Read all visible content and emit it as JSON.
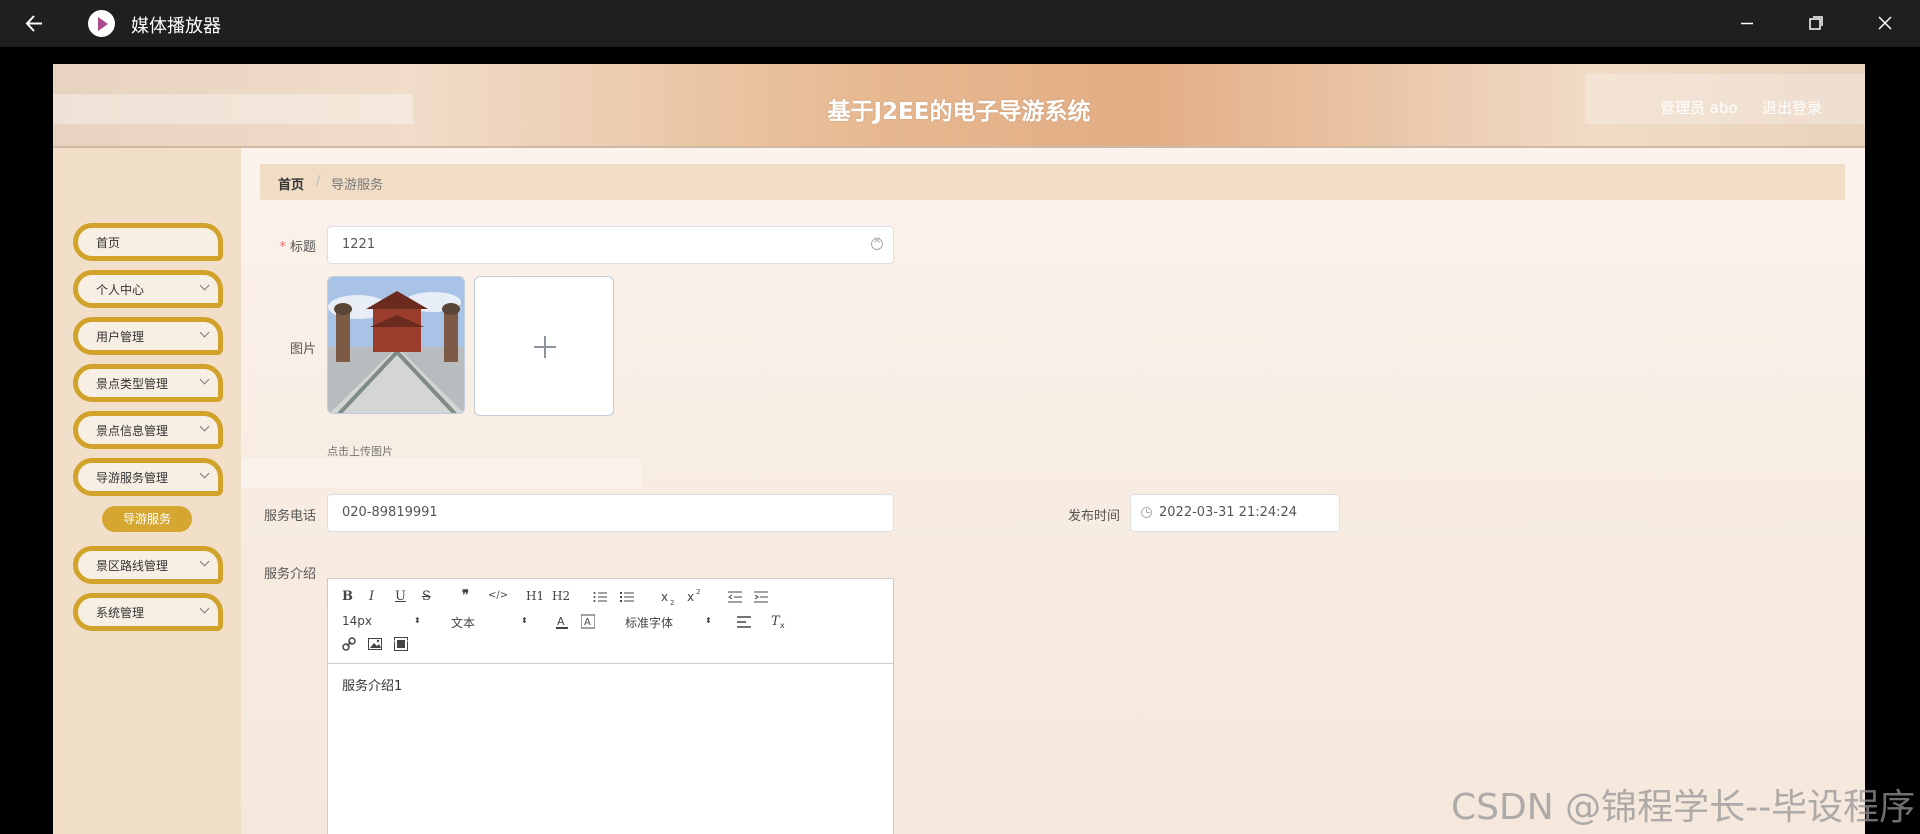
{
  "window": {
    "title": "媒体播放器"
  },
  "header": {
    "site_title": "基于J2EE的电子导游系统",
    "admin_label": "管理员 abo",
    "logout": "退出登录"
  },
  "sidebar": {
    "items": [
      {
        "label": "首页"
      },
      {
        "label": "个人中心"
      },
      {
        "label": "用户管理"
      },
      {
        "label": "景点类型管理"
      },
      {
        "label": "景点信息管理"
      },
      {
        "label": "导游服务管理"
      },
      {
        "label": "景区路线管理"
      },
      {
        "label": "系统管理"
      }
    ],
    "active_sub": "导游服务"
  },
  "breadcrumb": {
    "home": "首页",
    "separator": "/",
    "current": "导游服务"
  },
  "form": {
    "required_mark": "*",
    "title_label": "标题",
    "title_value": "1221",
    "image_label": "图片",
    "upload_hint": "点击上传图片",
    "phone_label": "服务电话",
    "phone_value": "020-89819991",
    "time_label": "发布时间",
    "time_value": "2022-03-31 21:24:24",
    "intro_label": "服务介绍",
    "intro_value": "服务介绍1"
  },
  "editor_toolbar": {
    "font_size": "14px",
    "header_select": "文本",
    "font_family": "标准字体",
    "buttons": [
      "B",
      "I",
      "U",
      "S",
      "❞",
      "</>",
      "H1",
      "H2"
    ]
  },
  "watermark": "CSDN @锦程学长--毕设程序"
}
